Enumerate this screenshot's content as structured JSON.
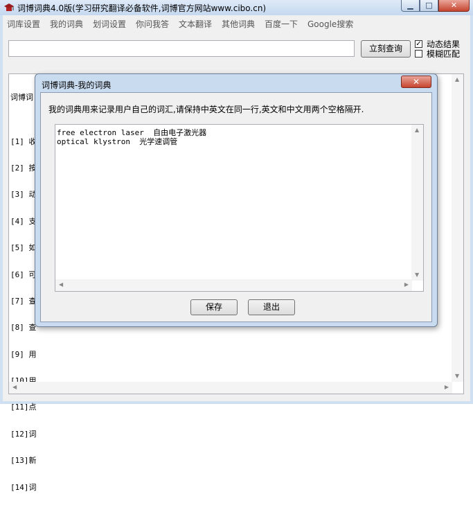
{
  "window": {
    "title": "词博词典4.0版(学习研究翻译必备软件,词博官方网站www.cibo.cn)",
    "icon": "mortarboard-icon"
  },
  "menu": [
    "词库设置",
    "我的词典",
    "划词设置",
    "你问我答",
    "文本翻译",
    "其他词典",
    "百度一下",
    "Google搜索"
  ],
  "search": {
    "value": "",
    "query_button": "立刻查询"
  },
  "options": [
    {
      "label": "动态结果",
      "checked": true
    },
    {
      "label": "模糊匹配",
      "checked": false
    }
  ],
  "result": {
    "lines": [
      "词博词",
      "",
      "[1] 收",
      "[2] 按",
      "[3] 动",
      "[4] 支",
      "[5] 如",
      "[6] 可",
      "[7] 查",
      "[8] 查",
      "[9] 用",
      "[10]用",
      "[11]点",
      "[12]词",
      "[13]新",
      "[14]词"
    ]
  },
  "dialog": {
    "title": "词博词典-我的词典",
    "description": "我的词典用来记录用户自己的词汇,请保持中英文在同一行,英文和中文用两个空格隔开.",
    "entries": [
      "free electron laser  自由电子激光器",
      "optical klystron  光学速调管"
    ],
    "save_button": "保存",
    "exit_button": "退出"
  }
}
